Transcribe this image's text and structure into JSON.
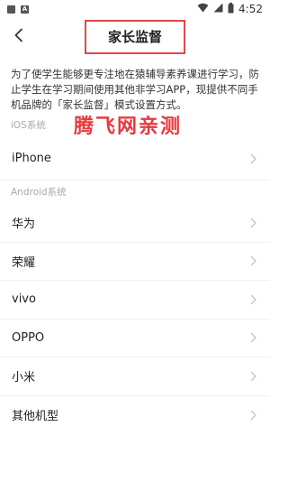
{
  "status_bar": {
    "time": "4:52",
    "left_icons": [
      "gallery-icon",
      "a-icon"
    ],
    "right_icons": [
      "wifi-icon",
      "signal-icon",
      "battery-icon"
    ]
  },
  "header": {
    "title": "家长监督",
    "back_icon": "back-arrow-icon",
    "highlight_color": "#e0484b"
  },
  "description": "为了使学生能够更专注地在猿辅导素养课进行学习，防止学生在学习期间使用其他非学习APP，现提供不同手机品牌的「家长监督」模式设置方式。",
  "watermark": "腾飞网亲测",
  "sections": [
    {
      "label": "iOS系统",
      "items": [
        {
          "label": "iPhone"
        }
      ]
    },
    {
      "label": "Android系统",
      "items": [
        {
          "label": "华为"
        },
        {
          "label": "荣耀"
        },
        {
          "label": "vivo"
        },
        {
          "label": "OPPO"
        },
        {
          "label": "小米"
        },
        {
          "label": "其他机型"
        }
      ]
    }
  ],
  "colors": {
    "watermark": "#e8393d",
    "section_label": "#a8a8a8",
    "chevron": "#c4c4c4"
  }
}
